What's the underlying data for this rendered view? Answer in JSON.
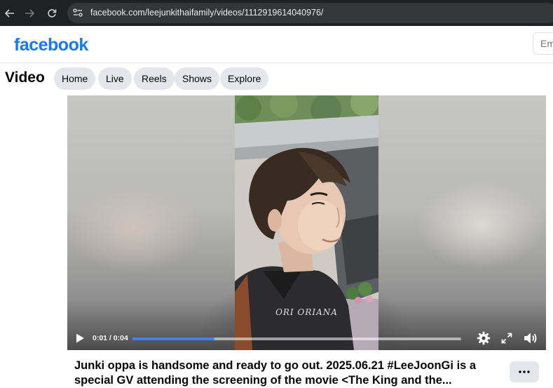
{
  "browser": {
    "url": "facebook.com/leejunkithaifamily/videos/1112919614040976/"
  },
  "header": {
    "logo": "facebook",
    "email_placeholder": "Em"
  },
  "video_nav": {
    "heading": "Video",
    "tabs": [
      {
        "label": "Home"
      },
      {
        "label": "Live"
      },
      {
        "label": "Reels"
      },
      {
        "label": "Shows"
      },
      {
        "label": "Explore"
      }
    ]
  },
  "player": {
    "watermark": "ORI ORIANA",
    "time_display": "0:01 / 0:04",
    "progress": 0.25,
    "accent_color": "#3b82f6"
  },
  "post": {
    "caption": "Junki oppa is handsome and ready to go out. 2025.06.21 #LeeJoonGi is a special GV attending the screening of the movie <The King and the..."
  },
  "icons": {
    "back": "back-arrow-icon",
    "forward": "forward-arrow-icon",
    "reload": "reload-icon",
    "site_info": "site-info-icon",
    "play": "play-icon",
    "settings": "gear-icon",
    "fullscreen": "fullscreen-icon",
    "volume": "volume-icon",
    "more": "more-icon"
  },
  "colors": {
    "brand": "#1877f2",
    "pill_bg": "#e4e6eb",
    "chrome_bg": "#202124"
  }
}
